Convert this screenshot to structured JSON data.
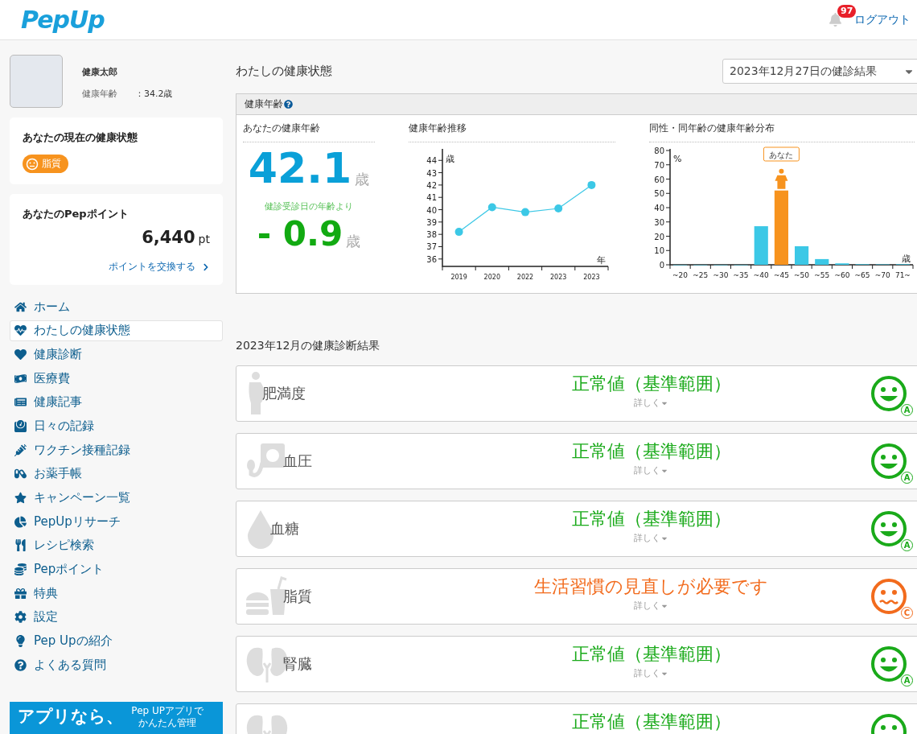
{
  "header": {
    "logo": "PepUp",
    "notification_count": "97",
    "logout": "ログアウト"
  },
  "profile": {
    "name": "健康太郎",
    "age_label": "健康年齢",
    "age_value": "：34.2歳"
  },
  "current_status": {
    "title": "あなたの現在の健康状態",
    "badges": [
      {
        "label": "脂質",
        "attention": true
      }
    ]
  },
  "points": {
    "title": "あなたのPepポイント",
    "value": "6,440",
    "unit": "pt",
    "link": "ポイントを交換する"
  },
  "nav": [
    {
      "label": "ホーム",
      "selected": false
    },
    {
      "label": "わたしの健康状態",
      "selected": true
    },
    {
      "label": "健康診断",
      "selected": false
    },
    {
      "label": "医療費",
      "selected": false
    },
    {
      "label": "健康記事",
      "selected": false
    },
    {
      "label": "日々の記録",
      "selected": false
    },
    {
      "label": "ワクチン接種記録",
      "selected": false
    },
    {
      "label": "お薬手帳",
      "selected": false
    },
    {
      "label": "キャンペーン一覧",
      "selected": false
    },
    {
      "label": "PepUpリサーチ",
      "selected": false
    },
    {
      "label": "レシピ検索",
      "selected": false
    },
    {
      "label": "Pepポイント",
      "selected": false
    },
    {
      "label": "特典",
      "selected": false
    },
    {
      "label": "設定",
      "selected": false
    },
    {
      "label": "Pep Upの紹介",
      "selected": false
    },
    {
      "label": "よくある質問",
      "selected": false
    }
  ],
  "banner": {
    "title": "アプリなら、",
    "note_lines": [
      "Pep UPアプリで",
      "かんたん管理"
    ]
  },
  "main": {
    "title": "わたしの健康状態",
    "select": "2023年12月27日の健診結果",
    "health_age": {
      "title": "健康年齢",
      "current": {
        "title": "あなたの健康年齢",
        "value": "42.1",
        "unit": "歳",
        "compare_label": "健診受診日の年齢より",
        "diff": "- 0.9",
        "diff_unit": "歳"
      },
      "trend": {
        "title": "健康年齢推移",
        "chart_data": {
          "type": "line",
          "xlabel": "年",
          "ylabel": "歳",
          "categories": [
            "2019",
            "2020",
            "2022",
            "2023",
            "2023"
          ],
          "series": [
            {
              "color": "#3cc8e6",
              "marker": "circle",
              "values": [
                38.2,
                40.2,
                39.8,
                40.1,
                42.0
              ]
            }
          ],
          "ylim": [
            35.4,
            44.8
          ],
          "yticks": [
            36,
            37,
            38,
            39,
            40,
            41,
            42,
            43,
            44
          ]
        }
      },
      "distribution": {
        "title": "同性・同年齢の健康年齢分布",
        "chart_data": {
          "type": "bar",
          "xlabel": "歳",
          "ylabel": "%",
          "categories": [
            "~20",
            "~25",
            "~30",
            "~35",
            "~40",
            "~45",
            "~50",
            "~55",
            "~60",
            "~65",
            "~70",
            "71~"
          ],
          "series": [
            {
              "color": "#3cc8e6",
              "values": [
                0,
                0,
                0,
                0,
                27,
                null,
                13,
                4,
                1,
                0.4,
                0.3,
                0.4
              ]
            },
            {
              "color": "#f7931e",
              "values": [
                null,
                null,
                null,
                null,
                null,
                52,
                null,
                null,
                null,
                null,
                null,
                null
              ]
            }
          ],
          "ylim": [
            0,
            80
          ],
          "yticks": [
            0,
            10,
            20,
            30,
            40,
            50,
            60,
            70,
            80
          ],
          "annotations": [
            "あなた"
          ]
        }
      }
    },
    "results": {
      "title": "2023年12月の健康診断結果",
      "items": [
        {
          "kind": "body",
          "name": "肥満度",
          "result": "正常値（基準範囲）",
          "more": "詳しく",
          "attention": false,
          "grade": "A"
        },
        {
          "kind": "pressure",
          "name": "血圧",
          "result": "正常値（基準範囲）",
          "more": "詳しく",
          "attention": false,
          "grade": "A"
        },
        {
          "kind": "drop",
          "name": "血糖",
          "result": "正常値（基準範囲）",
          "more": "詳しく",
          "attention": false,
          "grade": "A"
        },
        {
          "kind": "food",
          "name": "脂質",
          "result": "生活習慣の見直しが必要です",
          "more": "詳しく",
          "attention": true,
          "grade": "C"
        },
        {
          "kind": "kidney",
          "name": "腎臓",
          "result": "正常値（基準範囲）",
          "more": "詳しく",
          "attention": false,
          "grade": "A"
        },
        {
          "kind": "kidney",
          "result": "正常値（基準範囲）",
          "attention": false
        }
      ]
    }
  }
}
